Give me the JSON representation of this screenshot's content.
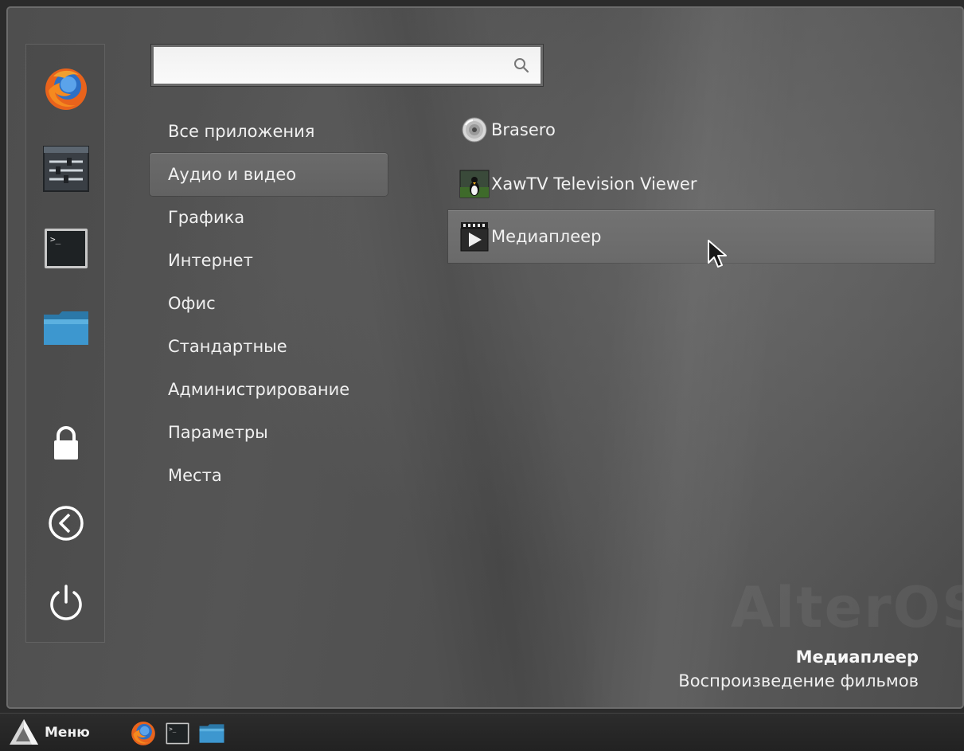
{
  "search": {
    "value": "",
    "icon": "search-icon"
  },
  "favorites": [
    {
      "name": "firefox",
      "icon": "firefox-icon"
    },
    {
      "name": "mixer",
      "icon": "sound-settings-icon"
    },
    {
      "name": "terminal",
      "icon": "terminal-icon"
    },
    {
      "name": "files",
      "icon": "folder-icon"
    },
    {
      "name": "lock",
      "icon": "lock-icon"
    },
    {
      "name": "logout",
      "icon": "logout-icon"
    },
    {
      "name": "power",
      "icon": "power-icon"
    }
  ],
  "categories": [
    {
      "label": "Все приложения",
      "active": false
    },
    {
      "label": "Аудио и видео",
      "active": true
    },
    {
      "label": "Графика",
      "active": false
    },
    {
      "label": "Интернет",
      "active": false
    },
    {
      "label": "Офис",
      "active": false
    },
    {
      "label": "Стандартные",
      "active": false
    },
    {
      "label": "Администрирование",
      "active": false
    },
    {
      "label": "Параметры",
      "active": false
    },
    {
      "label": "Места",
      "active": false
    }
  ],
  "apps": [
    {
      "label": "Brasero",
      "icon": "disc-icon",
      "hover": false
    },
    {
      "label": "XawTV Television Viewer",
      "icon": "tv-icon",
      "hover": false
    },
    {
      "label": "Медиаплеер",
      "icon": "video-player-icon",
      "hover": true
    }
  ],
  "description": {
    "title": "Медиаплеер",
    "subtitle": "Воспроизведение фильмов"
  },
  "watermark": "AlterOS",
  "taskbar": {
    "menu_label": "Меню",
    "launchers": [
      "firefox-icon",
      "terminal-icon",
      "folder-icon"
    ]
  },
  "colors": {
    "menu_bg": "#525252",
    "highlight": "#6b6b6b",
    "text": "#f0f0f0",
    "taskbar": "#262626"
  }
}
